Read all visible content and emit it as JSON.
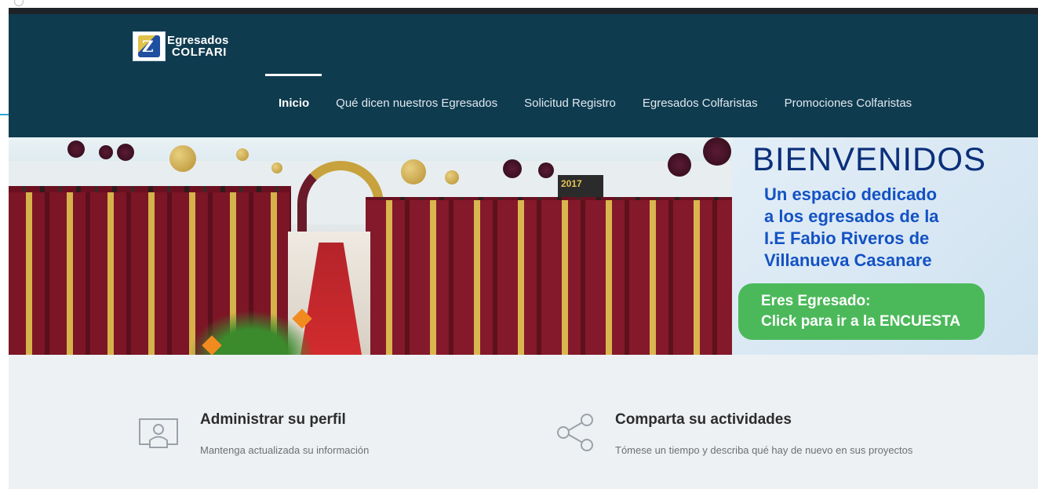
{
  "brand": {
    "logo_mark": "Z",
    "line1": "Egresados",
    "line2": "COLFARI"
  },
  "nav": {
    "items": [
      {
        "label": "Inicio",
        "active": true
      },
      {
        "label": "Qué dicen nuestros Egresados"
      },
      {
        "label": "Solicitud Registro"
      },
      {
        "label": "Egresados Colfaristas"
      },
      {
        "label": "Promociones Colfaristas"
      }
    ]
  },
  "banner": {
    "photo_sign": "2017",
    "heading": "BIENVENIDOS",
    "lines": [
      "Un espacio dedicado",
      "a los egresados de la",
      "I.E Fabio Riveros de",
      "Villanueva Casanare"
    ],
    "cta": {
      "line1": "Eres Egresado:",
      "line2": "Click para ir a la ENCUESTA"
    }
  },
  "features": [
    {
      "icon": "profile-icon",
      "title": "Administrar su perfil",
      "description": "Mantenga actualizada su información"
    },
    {
      "icon": "share-icon",
      "title": "Comparta su actividades",
      "description": "Tómese un tiempo y describa qué hay de nuevo en sus proyectos"
    }
  ],
  "colors": {
    "header_bg": "#0f3b4f",
    "nav_text": "#dfe8ee",
    "welcome_title": "#0b2f7a",
    "welcome_text": "#1352c4",
    "cta_bg": "#4bb95a",
    "features_bg": "#eef1f4"
  }
}
